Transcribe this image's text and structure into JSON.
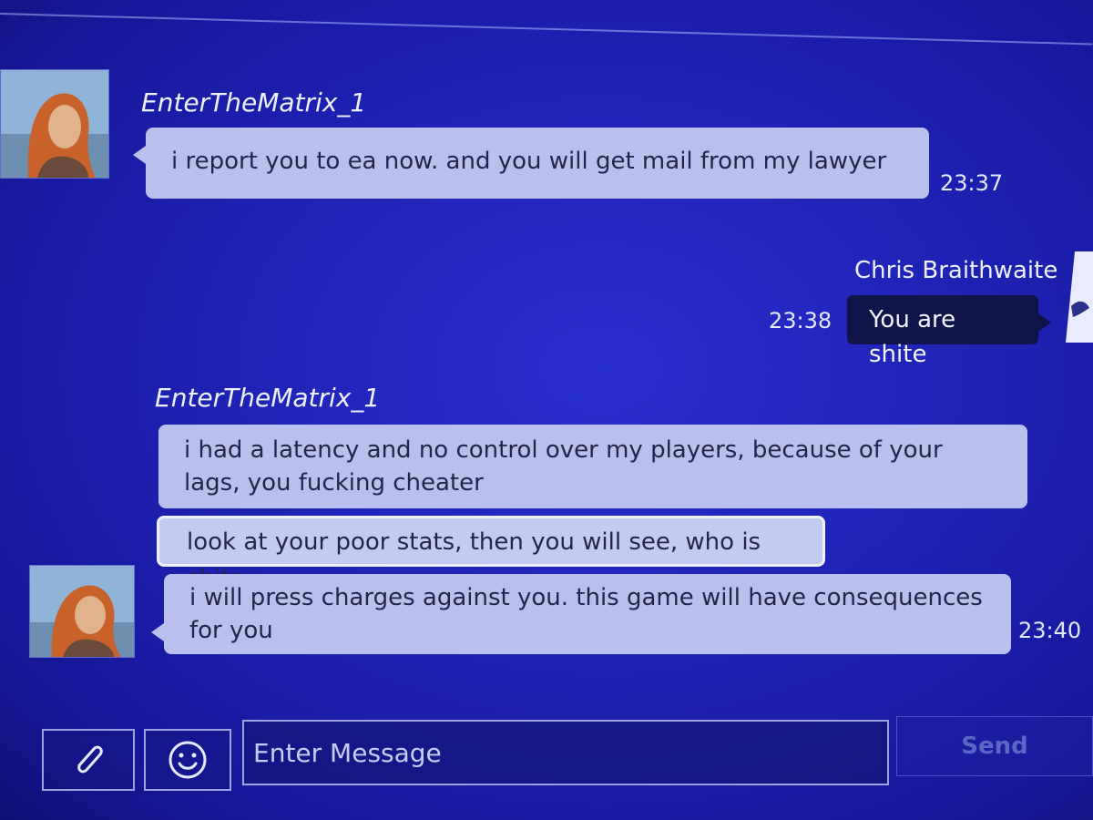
{
  "composer": {
    "placeholder": "Enter Message",
    "send_label": "Send"
  },
  "messages": [
    {
      "sender": "EnterTheMatrix_1",
      "text": "i report you to ea now. and you will get mail from my lawyer",
      "time": "23:37"
    },
    {
      "sender": "Chris Braithwaite",
      "text": "You are shite",
      "time": "23:38"
    },
    {
      "sender": "EnterTheMatrix_1",
      "texts": [
        "i had a latency and no control over my players, because of your lags, you fucking cheater",
        "look at your poor stats, then you will see, who is shite",
        "i will press charges against you. this game will have consequences for you"
      ],
      "time": "23:40"
    }
  ],
  "icons": {
    "attach": "paperclip-icon",
    "emoji": "smiley-icon"
  },
  "colors": {
    "background": "#1e22b4",
    "bubble_incoming": "#b9c0ee",
    "bubble_outgoing": "#0f1548",
    "send_text": "#5a67c8"
  }
}
